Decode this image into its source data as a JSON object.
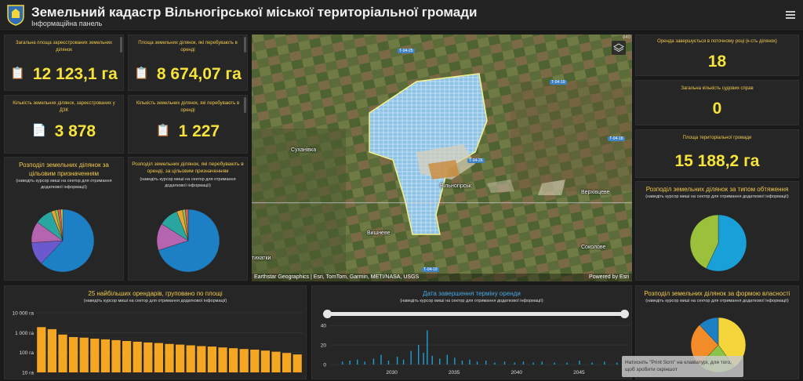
{
  "header": {
    "title": "Земельний кадастр Вільногірської міської територіальної громади",
    "subtitle": "Інформаційна панель"
  },
  "kpis": {
    "total_area": {
      "label": "Загальна площа зареєстрованих земельних ділянок",
      "value": "12 123,1 га"
    },
    "lease_area": {
      "label": "Площа земельних ділянок, які перебувають в оренді",
      "value": "8 674,07 га"
    },
    "parcel_count": {
      "label": "Кількість земельних ділянок, зареєстрованих у ДЗК",
      "value": "3 878"
    },
    "lease_count": {
      "label": "Кількість земельних ділянок, які перебувають в оренді",
      "value": "1 227"
    },
    "lease_ending": {
      "label": "Оренда завершується в поточному році (к-сть ділянок)",
      "value": "18"
    },
    "court_cases": {
      "label": "Загальна кількість судових справ",
      "value": "0"
    },
    "community_area": {
      "label": "Площа територіальної громади",
      "value": "15 188,2 га"
    }
  },
  "pies": {
    "purpose": {
      "title": "Розподіл земельних ділянок за цільовим призначенням",
      "note": "(наведіть курсор миші на сектор для отримання додаткової інформації)"
    },
    "lease_purpose": {
      "title": "Розподіл земельних ділянок, які перебувають в оренді, за цільовим призначенням",
      "note": "(наведіть курсор миші на сектор для отримання додаткової інформації)"
    },
    "encumbrance": {
      "title": "Розподіл земельних ділянок за типом обтяження",
      "note": "(наведіть курсор миші на сектор для отримання додаткової інформації)"
    },
    "ownership": {
      "title": "Розподіл земельних ділянок за формою власності",
      "note": "(наведіть курсор миші на сектор для отримання додаткової інформації)"
    }
  },
  "bar_panel": {
    "title": "25 найбільших орендарів, груповано по площі",
    "note": "(наведіть курсор миші на сектор для отримання додаткової інформації)"
  },
  "timeline_panel": {
    "title": "Дата завершення терміну оренди",
    "note": "(наведіть курсор миші на сектор для отримання додаткової інформації)"
  },
  "map": {
    "labels": {
      "city": "Вільногірськ",
      "sukhachivka": "Суханівка",
      "vyshneve": "Вишневе",
      "verkhivtseve": "Верхівцеве",
      "sokolove": "Соколове",
      "tykhatky": "тихатки"
    },
    "roads": [
      "Т-04-25",
      "Т-04-19",
      "Т-04-18",
      "Т-04-26",
      "Т-04-19"
    ],
    "scale": "840",
    "attribution": "Earthstar Geographics | Esri, TomTom, Garmin, METI/NASA, USGS",
    "powered": "Powered by Esri"
  },
  "tooltip": {
    "text": "Натисніть \"Print Scrn\" на клавіатурі, для того, щоб зробити скріншот"
  },
  "chart_data": [
    {
      "type": "pie",
      "title": "Розподіл земельних ділянок за цільовим призначенням",
      "values": [
        62,
        12,
        11,
        9,
        2,
        1.5,
        1.5,
        1
      ],
      "colors": [
        "#1d7fc4",
        "#6a5acd",
        "#b564b0",
        "#2aa6a0",
        "#e6a63c",
        "#8bc34a",
        "#e25b5b",
        "#cfcf4f"
      ]
    },
    {
      "type": "pie",
      "title": "Розподіл земельних ділянок, які перебувають в оренді, за цільовим призначенням",
      "values": [
        70,
        14,
        10,
        3,
        1.5,
        1.5
      ],
      "colors": [
        "#1d7fc4",
        "#b564b0",
        "#2aa6a0",
        "#e6a63c",
        "#8bc34a",
        "#e25b5b"
      ]
    },
    {
      "type": "pie",
      "title": "Розподіл земельних ділянок за типом обтяження",
      "values": [
        57,
        43
      ],
      "colors": [
        "#1aa0d8",
        "#9bc13c"
      ]
    },
    {
      "type": "pie",
      "title": "Розподіл земельних ділянок за формою власності",
      "values": [
        40,
        22,
        26,
        12
      ],
      "colors": [
        "#f5d63a",
        "#8bc34a",
        "#f28c28",
        "#1d7fc4"
      ]
    },
    {
      "type": "bar",
      "title": "25 найбільших орендарів, груповано по площі",
      "scale": "log",
      "yticks": [
        "10 000 га",
        "1 000 га",
        "100 га",
        "10 га"
      ],
      "ytick_values": [
        10000,
        1000,
        100,
        10
      ],
      "values": [
        1900,
        1500,
        800,
        600,
        560,
        500,
        460,
        420,
        380,
        350,
        320,
        300,
        270,
        250,
        230,
        210,
        200,
        180,
        165,
        150,
        140,
        125,
        110,
        95,
        80
      ],
      "color": "#f5a623"
    },
    {
      "type": "bar",
      "title": "Дата завершення терміну оренди",
      "xticks": [
        "2030",
        "2035",
        "2040",
        "2045"
      ],
      "xtick_values": [
        2030,
        2035,
        2040,
        2045
      ],
      "yticks": [
        "40",
        "20",
        "0"
      ],
      "ylim": [
        0,
        45
      ],
      "x_range": [
        2025,
        2049
      ],
      "values": [
        [
          2026,
          3
        ],
        [
          2026.6,
          4
        ],
        [
          2027.2,
          5
        ],
        [
          2027.8,
          3
        ],
        [
          2028.5,
          6
        ],
        [
          2029.1,
          10
        ],
        [
          2029.7,
          4
        ],
        [
          2030.4,
          8
        ],
        [
          2030.9,
          5
        ],
        [
          2031.5,
          14
        ],
        [
          2032.1,
          20
        ],
        [
          2032.5,
          12
        ],
        [
          2032.8,
          35
        ],
        [
          2033.2,
          9
        ],
        [
          2033.8,
          6
        ],
        [
          2034.4,
          10
        ],
        [
          2035,
          7
        ],
        [
          2035.6,
          4
        ],
        [
          2036.2,
          5
        ],
        [
          2036.8,
          3
        ],
        [
          2037.5,
          4
        ],
        [
          2038.2,
          2
        ],
        [
          2039,
          3
        ],
        [
          2039.8,
          2
        ],
        [
          2040.5,
          3
        ],
        [
          2041.3,
          2
        ],
        [
          2042,
          3
        ],
        [
          2043,
          2
        ],
        [
          2044,
          2
        ],
        [
          2045,
          4
        ],
        [
          2046,
          2
        ],
        [
          2047,
          3
        ],
        [
          2048,
          2
        ]
      ],
      "color": "#1aa0d8"
    }
  ]
}
